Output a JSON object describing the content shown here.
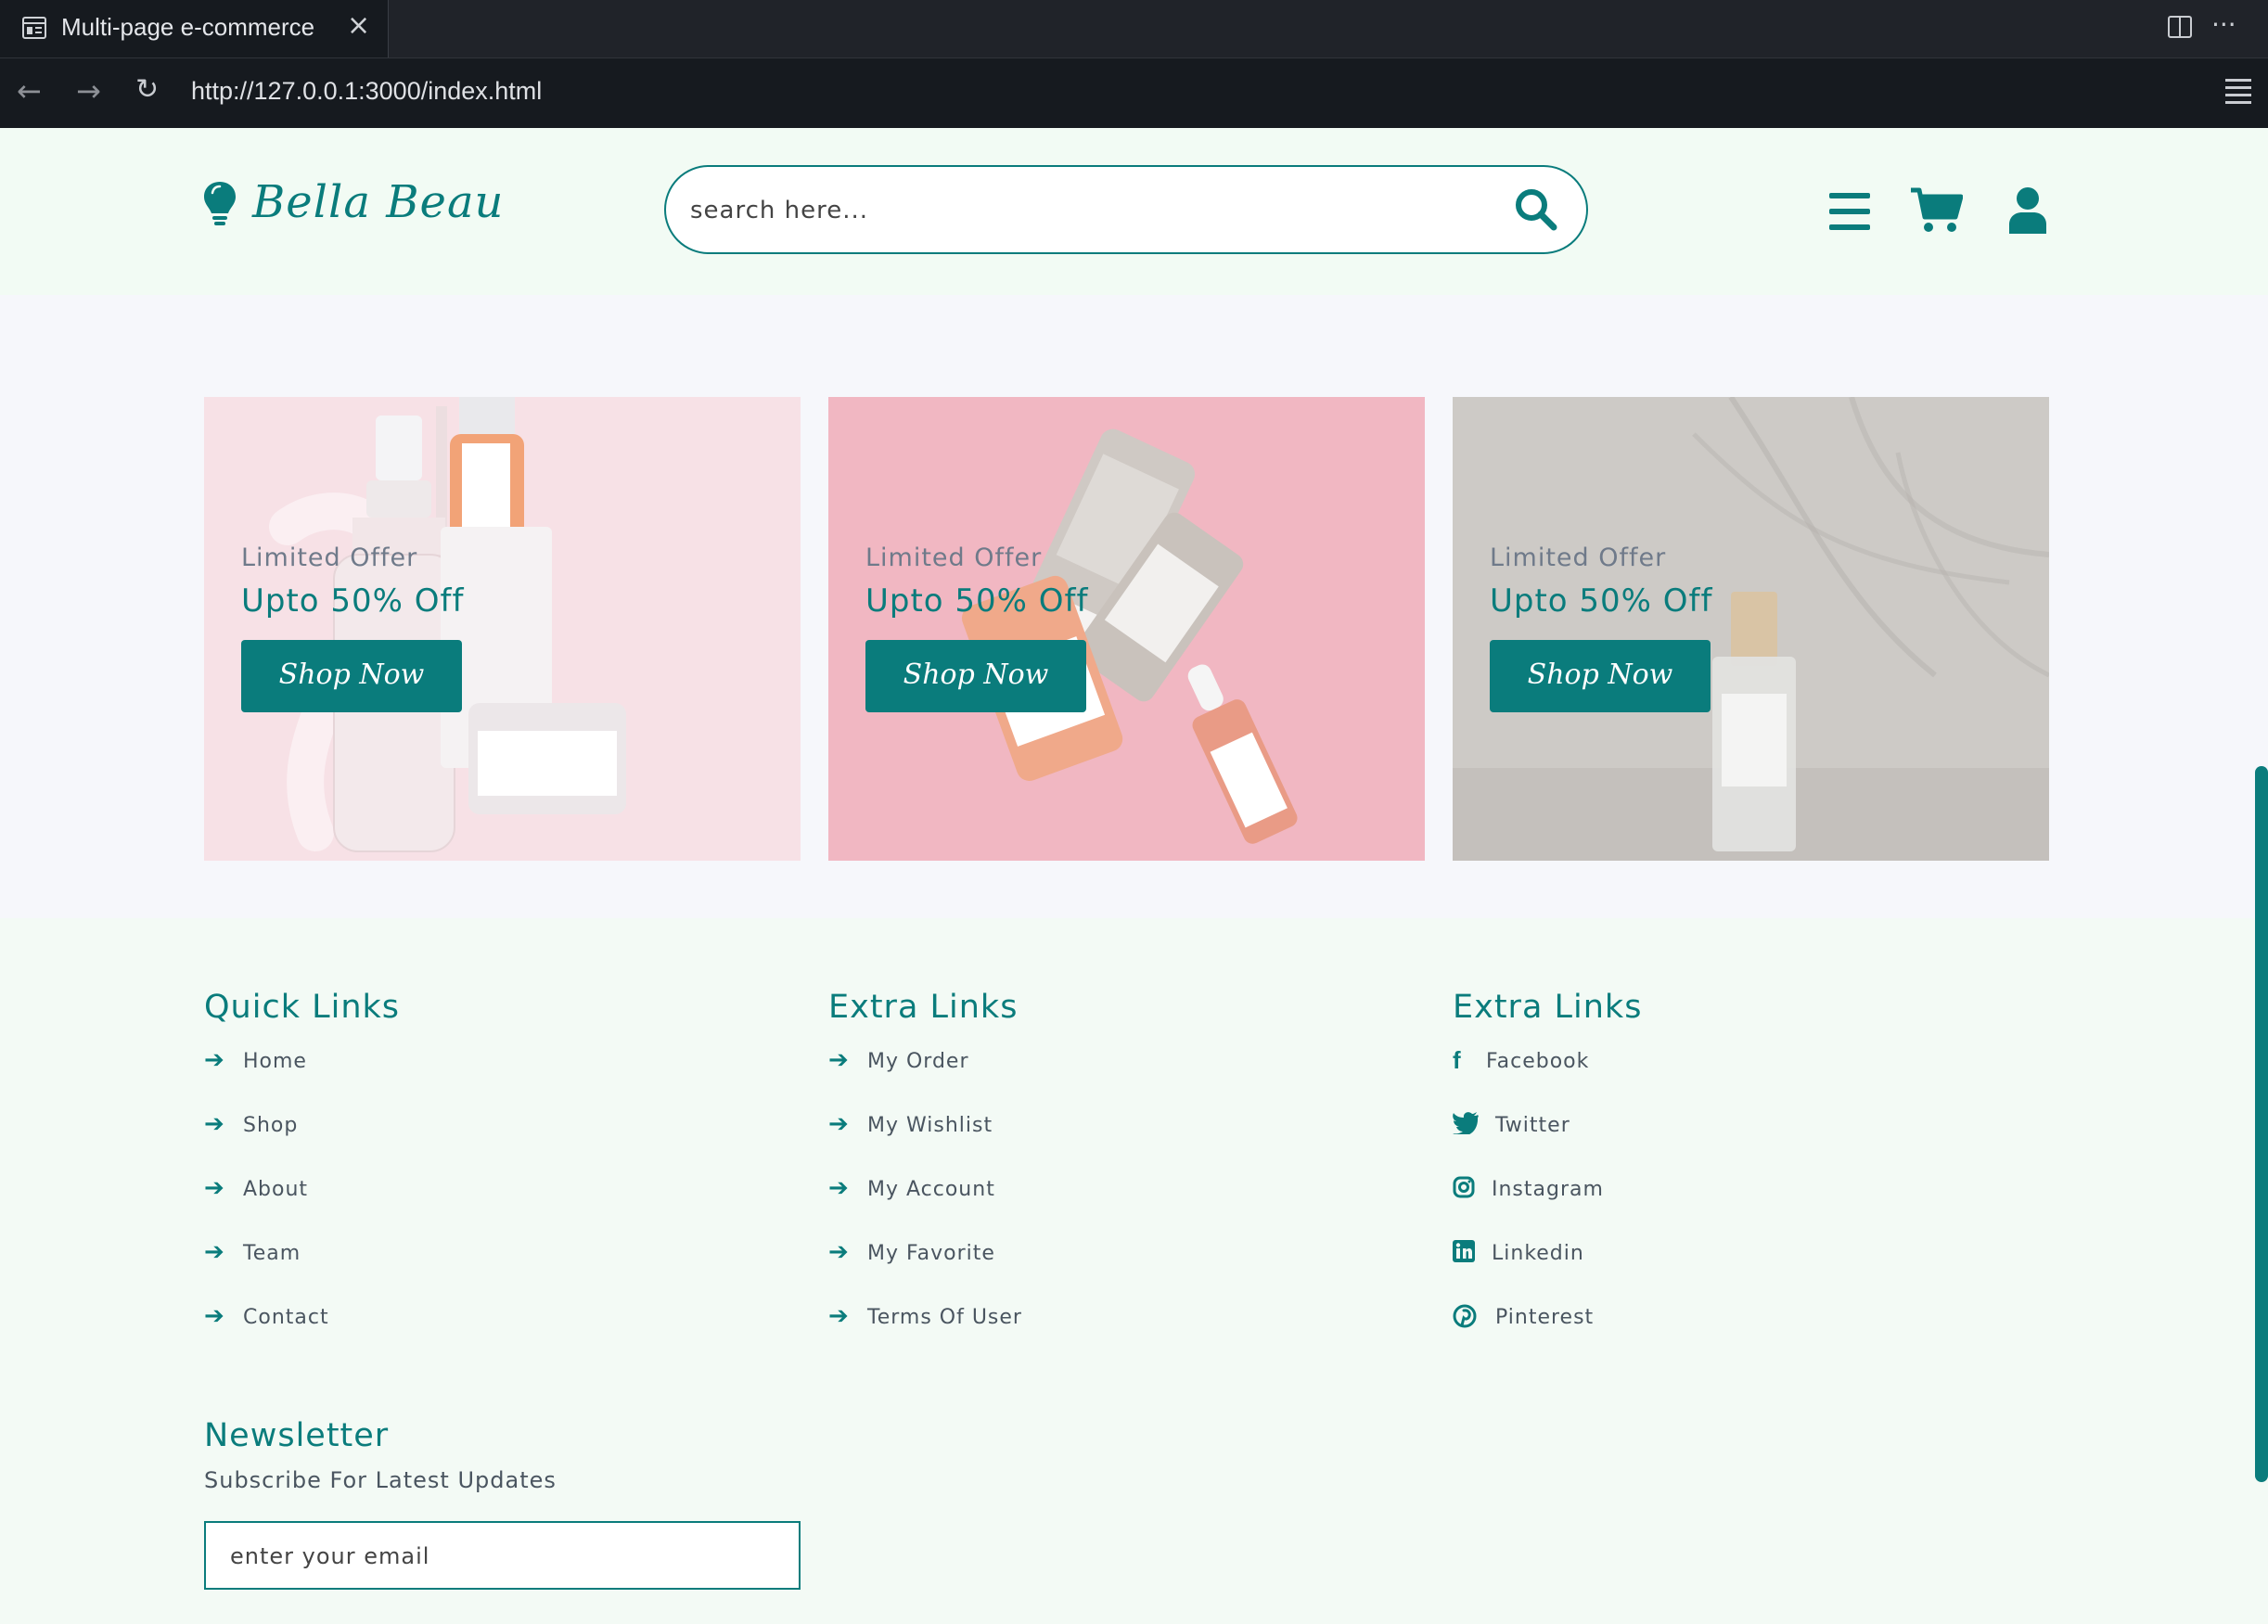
{
  "browser": {
    "tab_title": "Multi-page e-commerce",
    "url": "http://127.0.0.1:3000/index.html"
  },
  "header": {
    "logo": "Bella Beau",
    "search_placeholder": "search here..."
  },
  "banners": [
    {
      "subtitle": "Limited Offer",
      "title": "Upto 50% Off",
      "button": "Shop Now"
    },
    {
      "subtitle": "Limited Offer",
      "title": "Upto 50% Off",
      "button": "Shop Now"
    },
    {
      "subtitle": "Limited Offer",
      "title": "Upto 50% Off",
      "button": "Shop Now"
    }
  ],
  "footer": {
    "quick_links": {
      "title": "Quick Links",
      "items": [
        "Home",
        "Shop",
        "About",
        "Team",
        "Contact"
      ]
    },
    "extra_links": {
      "title": "Extra Links",
      "items": [
        "My Order",
        "My Wishlist",
        "My Account",
        "My Favorite",
        "Terms Of User"
      ]
    },
    "social_links": {
      "title": "Extra Links",
      "items": [
        "Facebook",
        "Twitter",
        "Instagram",
        "Linkedin",
        "Pinterest"
      ]
    },
    "newsletter": {
      "title": "Newsletter",
      "subtitle": "Subscribe For Latest Updates",
      "placeholder": "enter your email"
    }
  },
  "colors": {
    "accent": "#0a7c7c",
    "header_bg": "#f2fbf4",
    "banner_bg": "#f6f7fb"
  }
}
